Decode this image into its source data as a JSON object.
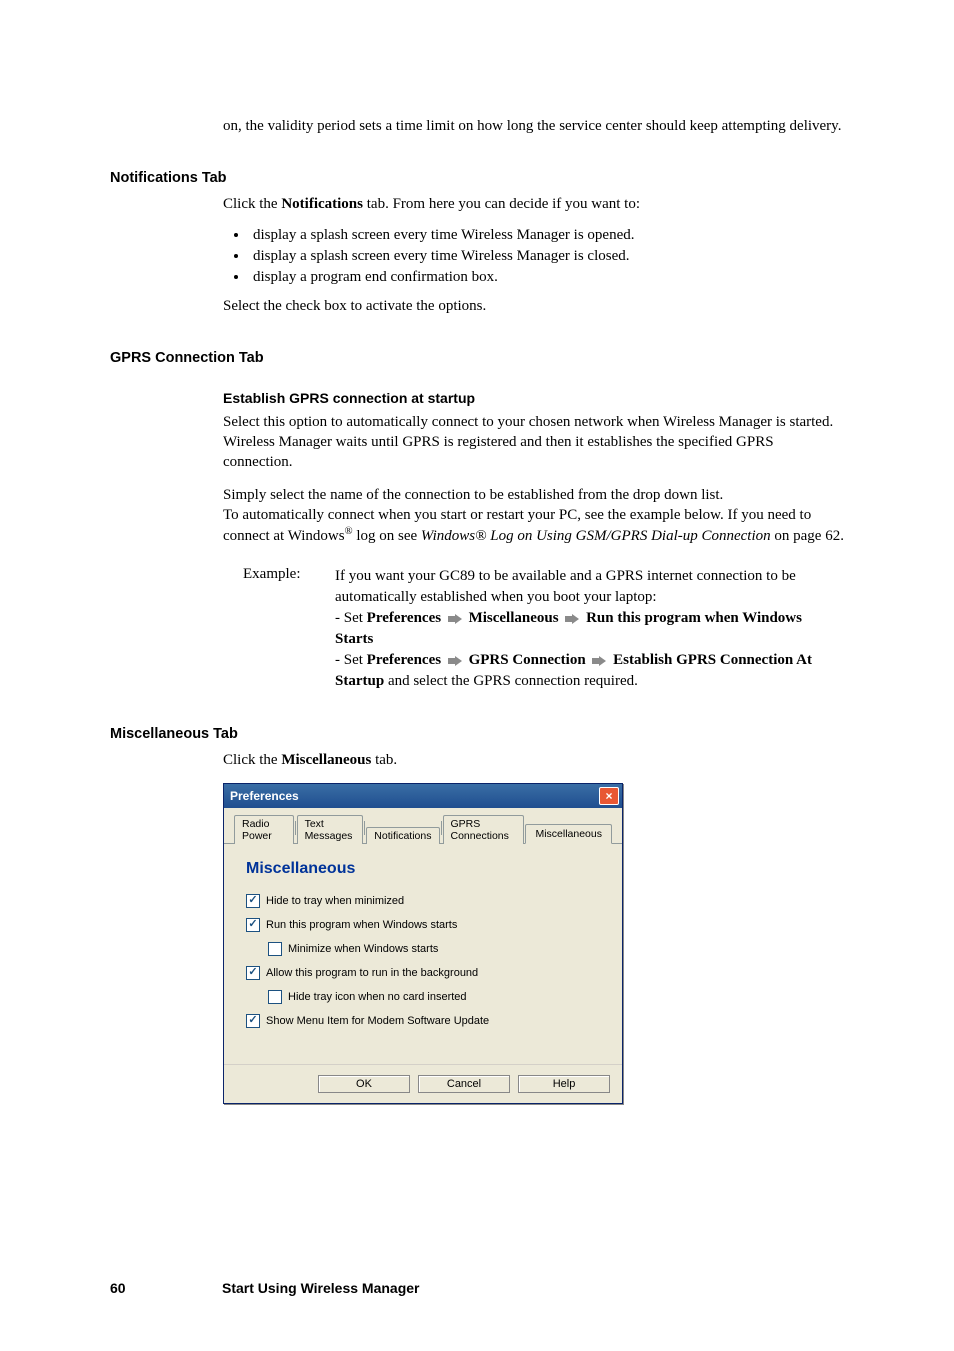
{
  "intro": {
    "validity_text": "on, the validity period sets a time limit on how long the service center should keep attempting delivery."
  },
  "notifications": {
    "heading": "Notifications Tab",
    "click_prefix": "Click the ",
    "click_bold": "Notifications",
    "click_suffix": " tab. From here you can decide if you want to:",
    "bullets": [
      "display a splash screen every time Wireless Manager is opened.",
      "display a splash screen every time Wireless Manager is closed.",
      "display a program end confirmation box."
    ],
    "after": "Select the check box to activate the options."
  },
  "gprs": {
    "heading": "GPRS Connection Tab",
    "sub_heading": "Establish GPRS connection at startup",
    "para1": "Select this option to automatically connect to your chosen network when Wireless Manager is started. Wireless Manager waits until GPRS is registered and then it establishes the specified GPRS connection.",
    "para2a": "Simply select the name of the connection to be established from the drop down list.",
    "para2b_a": "To automatically connect when you start or restart your PC, see the example below. If you need to connect at Windows",
    "para2b_sup": "®",
    "para2b_b": " log on see ",
    "para2b_italic": "Windows® Log on Using GSM/GPRS Dial-up Connection",
    "para2b_c": " on page 62.",
    "example_label": "Example:",
    "ex_line1": "If you want your GC89 to be available and a GPRS internet connection to be automatically established when you boot your laptop:",
    "ex_seq1_a": "- Set ",
    "ex_seq1_pref": "Preferences",
    "ex_seq1_misc": "Miscellaneous",
    "ex_seq1_run": "Run this program when Windows Starts",
    "ex_seq2_a": "- Set ",
    "ex_seq2_pref": "Preferences",
    "ex_seq2_gprs": "GPRS Connection",
    "ex_seq2_est": "Establish GPRS Connection At Startup",
    "ex_seq2_tail": " and select the GPRS connection required."
  },
  "misc": {
    "heading": "Miscellaneous Tab",
    "click_prefix": "Click the ",
    "click_bold": "Miscellaneous",
    "click_suffix": " tab."
  },
  "dialog": {
    "title": "Preferences",
    "tabs": [
      "Radio Power",
      "Text Messages",
      "Notifications",
      "GPRS Connections",
      "Miscellaneous"
    ],
    "active_tab_index": 4,
    "panel_heading": "Miscellaneous",
    "options": [
      {
        "label": "Hide to tray when minimized",
        "checked": true,
        "indent": false
      },
      {
        "label": "Run this program when Windows starts",
        "checked": true,
        "indent": false
      },
      {
        "label": "Minimize when Windows starts",
        "checked": false,
        "indent": true
      },
      {
        "label": "Allow this program to run in the background",
        "checked": true,
        "indent": false
      },
      {
        "label": "Hide tray icon when no card inserted",
        "checked": false,
        "indent": true
      },
      {
        "label": "Show Menu Item for Modem Software Update",
        "checked": true,
        "indent": false
      }
    ],
    "buttons": {
      "ok": "OK",
      "cancel": "Cancel",
      "help": "Help"
    }
  },
  "footer": {
    "page": "60",
    "title": "Start Using Wireless Manager"
  }
}
